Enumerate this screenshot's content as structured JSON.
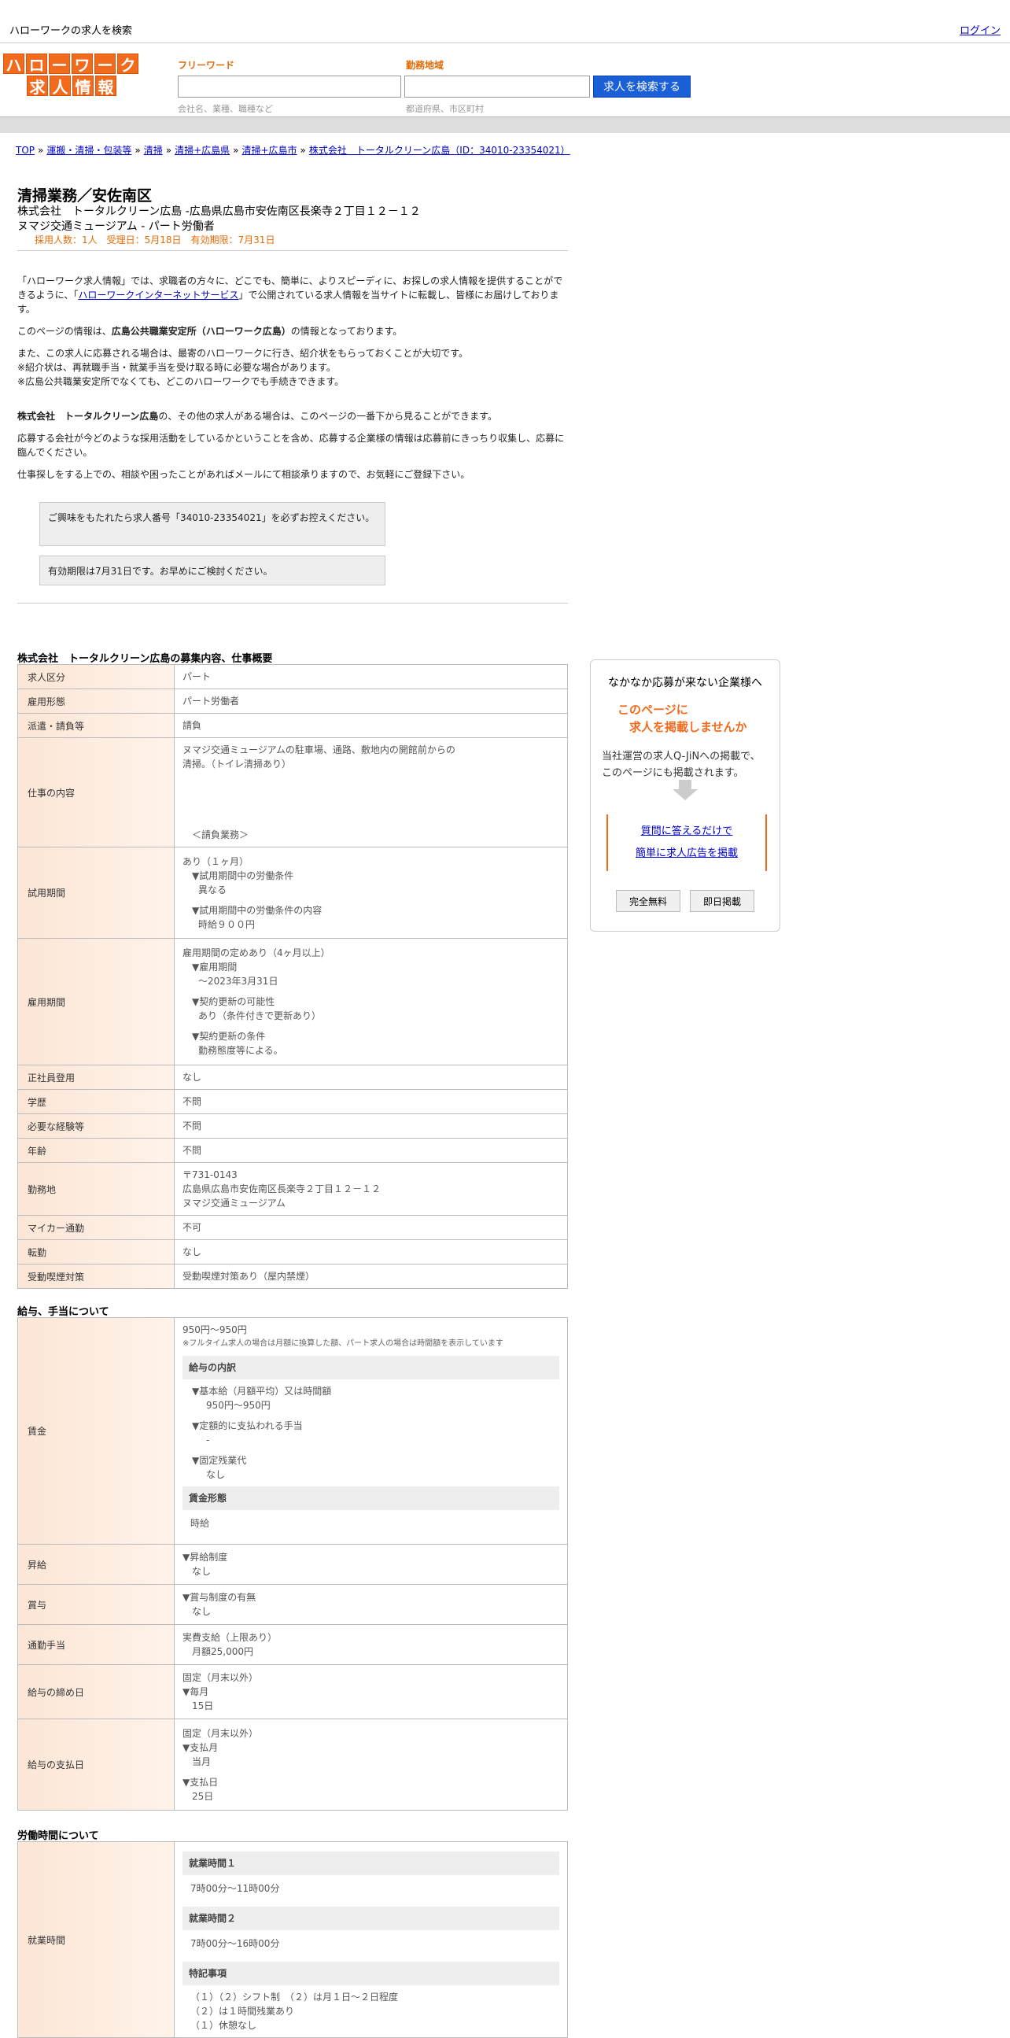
{
  "header": {
    "site_title": "ハローワークの求人を検索",
    "login": "ログイン",
    "logo_row1": [
      "ハ",
      "ロ",
      "ー",
      "ワ",
      "ー",
      "ク"
    ],
    "logo_row2": [
      "求",
      "人",
      "情",
      "報"
    ],
    "freeword_label": "フリーワード",
    "area_label": "勤務地域",
    "freeword_hint": "会社名、業種、職種など",
    "area_hint": "都道府県、市区町村",
    "search_button": "求人を検索する"
  },
  "breadcrumb": [
    "TOP",
    "運搬・清掃・包装等",
    "清掃",
    "清掃+広島県",
    "清掃+広島市",
    "株式会社　トータルクリーン広島（ID：34010-23354021）"
  ],
  "job": {
    "title": "清掃業務／安佐南区",
    "company_line": "株式会社　トータルクリーン広島 -広島県広島市安佐南区長楽寺２丁目１２－１２",
    "work_line": "ヌマジ交通ミュージアム - パート労働者",
    "meta": "採用人数：1人　受理日：5月18日　有効期限：7月31日"
  },
  "intro": {
    "p1_a": "「ハローワーク求人情報」では、求職者の方々に、どこでも、簡単に、よりスピーディに、お探しの求人情報を提供することができるように、「",
    "p1_link": "ハローワークインターネットサービス",
    "p1_b": "」で公開されている求人情報を当サイトに転載し、皆様にお届けしております。",
    "p2_a": "このページの情報は、",
    "p2_bold": "広島公共職業安定所（ハローワーク広島）",
    "p2_b": "の情報となっております。",
    "p3_1": "また、この求人に応募される場合は、最寄のハローワークに行き、紹介状をもらっておくことが大切です。",
    "p3_2": "※紹介状は、再就職手当・就業手当を受け取る時に必要な場合があります。",
    "p3_3": "※広島公共職業安定所でなくても、どこのハローワークでも手続きできます。",
    "p4_bold": "株式会社　トータルクリーン広島",
    "p4_b": "の、その他の求人がある場合は、このページの一番下から見ることができます。",
    "p5": "応募する会社が今どのような採用活動をしているかということを含め、応募する企業様の情報は応募前にきっちり収集し、応募に臨んでください。",
    "p6": "仕事探しをする上での、相談や困ったことがあればメールにて相談承りますので、お気軽にご登録下さい。",
    "notice1": "ご興味をもたれたら求人番号「34010-23354021」を必ずお控えください。",
    "notice2": "有効期限は7月31日です。お早めにご検討ください。"
  },
  "section1": {
    "title": "株式会社　トータルクリーン広島の募集内容、仕事概要",
    "rows": {
      "kubun": {
        "label": "求人区分",
        "value": "パート"
      },
      "keitai": {
        "label": "雇用形態",
        "value": "パート労働者"
      },
      "haken": {
        "label": "派遣・請負等",
        "value": "請負"
      },
      "naiyo": {
        "label": "仕事の内容",
        "line1": "ヌマジ交通ミュージアムの駐車場、通路、敷地内の開館前からの",
        "line2": "清掃。（トイレ清掃あり）",
        "line3": "＜請負業務＞"
      },
      "shiyo": {
        "label": "試用期間",
        "v1": "あり（１ヶ月）",
        "v2": "▼試用期間中の労働条件",
        "v3": "異なる",
        "v4": "▼試用期間中の労働条件の内容",
        "v5": "時給９００円"
      },
      "koyo": {
        "label": "雇用期間",
        "v1": "雇用期間の定めあり（4ヶ月以上）",
        "v2": "▼雇用期間",
        "v3": "〜2023年3月31日",
        "v4": "▼契約更新の可能性",
        "v5": "あり（条件付きで更新あり）",
        "v6": "▼契約更新の条件",
        "v7": "勤務態度等による。"
      },
      "seishain": {
        "label": "正社員登用",
        "value": "なし"
      },
      "gakureki": {
        "label": "学歴",
        "value": "不問"
      },
      "keiken": {
        "label": "必要な経験等",
        "value": "不問"
      },
      "nenrei": {
        "label": "年齢",
        "value": "不問"
      },
      "kinmuchi": {
        "label": "勤務地",
        "v1": "〒731-0143",
        "v2": "広島県広島市安佐南区長楽寺２丁目１２－１２",
        "v3": "ヌマジ交通ミュージアム"
      },
      "mycar": {
        "label": "マイカー通勤",
        "value": "不可"
      },
      "tenkin": {
        "label": "転勤",
        "value": "なし"
      },
      "kitsuen": {
        "label": "受動喫煙対策",
        "value": "受動喫煙対策あり（屋内禁煙）"
      }
    }
  },
  "section2": {
    "title": "給与、手当について",
    "chingin": {
      "label": "賃金",
      "v1": "950円〜950円",
      "note": "※フルタイム求人の場合は月額に換算した額、パート求人の場合は時間額を表示しています",
      "h1": "給与の内訳",
      "v2": "▼基本給（月額平均）又は時間額",
      "v3": "950円〜950円",
      "v4": "▼定額的に支払われる手当",
      "v5": "-",
      "v6": "▼固定残業代",
      "v7": "なし",
      "h2": "賃金形態",
      "v8": "時給"
    },
    "shokyu": {
      "label": "昇給",
      "v1": "▼昇給制度",
      "v2": "なし"
    },
    "shoyo": {
      "label": "賞与",
      "v1": "▼賞与制度の有無",
      "v2": "なし"
    },
    "tsukin": {
      "label": "通勤手当",
      "v1": "実費支給（上限あり）",
      "v2": "月額25,000円"
    },
    "shime": {
      "label": "給与の締め日",
      "v1": "固定（月末以外）",
      "v2": "▼毎月",
      "v3": "15日"
    },
    "shiharai": {
      "label": "給与の支払日",
      "v1": "固定（月末以外）",
      "v2": "▼支払月",
      "v3": "当月",
      "v4": "▼支払日",
      "v5": "25日"
    }
  },
  "section3": {
    "title": "労働時間について",
    "shugyo": {
      "label": "就業時間",
      "h1": "就業時間１",
      "v1": "7時00分〜11時00分",
      "h2": "就業時間２",
      "v2": "7時00分〜16時00分",
      "h3": "特記事項",
      "v3": "（１）（２）シフト制　（２）は月１日～２日程度",
      "v4": "（２）は１時間残業あり",
      "v5": "（１）休憩なし"
    }
  },
  "ad": {
    "title": "なかなか応募が来ない企業様へ",
    "orange1": "このページに",
    "orange2": "　求人を掲載しませんか",
    "text1": "当社運営の求人Q-JiNへの掲載で、",
    "text2": "このページにも掲載されます。",
    "link1": "質問に答えるだけで",
    "link2": "簡単に求人広告を掲載",
    "btn1": "完全無料",
    "btn2": "即日掲載"
  },
  "colors": {
    "accent": "#f26b1d",
    "link": "#0000cc",
    "button": "#1a5fd6"
  }
}
